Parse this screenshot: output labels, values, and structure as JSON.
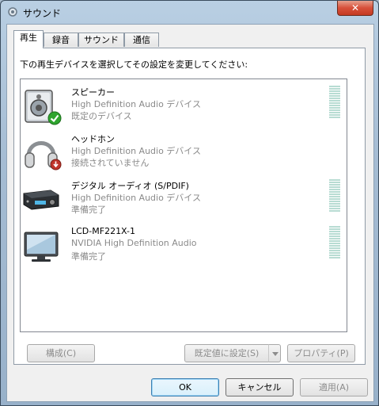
{
  "window": {
    "title": "サウンド",
    "close_glyph": "✕"
  },
  "tabs": [
    {
      "label": "再生",
      "active": true
    },
    {
      "label": "録音",
      "active": false
    },
    {
      "label": "サウンド",
      "active": false
    },
    {
      "label": "通信",
      "active": false
    }
  ],
  "instruction": "下の再生デバイスを選択してその設定を変更してください:",
  "devices": [
    {
      "name": "スピーカー",
      "desc": "High Definition Audio デバイス",
      "status": "既定のデバイス",
      "icon": "speaker-icon",
      "badge": "default-checkmark-icon"
    },
    {
      "name": "ヘッドホン",
      "desc": "High Definition Audio デバイス",
      "status": "接続されていません",
      "icon": "headphones-icon",
      "badge": "unplugged-icon"
    },
    {
      "name": "デジタル オーディオ (S/PDIF)",
      "desc": "High Definition Audio デバイス",
      "status": "準備完了",
      "icon": "digital-audio-receiver-icon"
    },
    {
      "name": "LCD-MF221X-1",
      "desc": "NVIDIA High Definition Audio",
      "status": "準備完了",
      "icon": "lcd-monitor-icon"
    }
  ],
  "buttons": {
    "configure": "構成(C)",
    "set_default": "既定値に設定(S)",
    "properties": "プロパティ(P)",
    "ok": "OK",
    "cancel": "キャンセル",
    "apply": "適用(A)"
  },
  "colors": {
    "check": "#2fa52f",
    "unplugged": "#c0352b",
    "meter": "#b8dcd3"
  }
}
